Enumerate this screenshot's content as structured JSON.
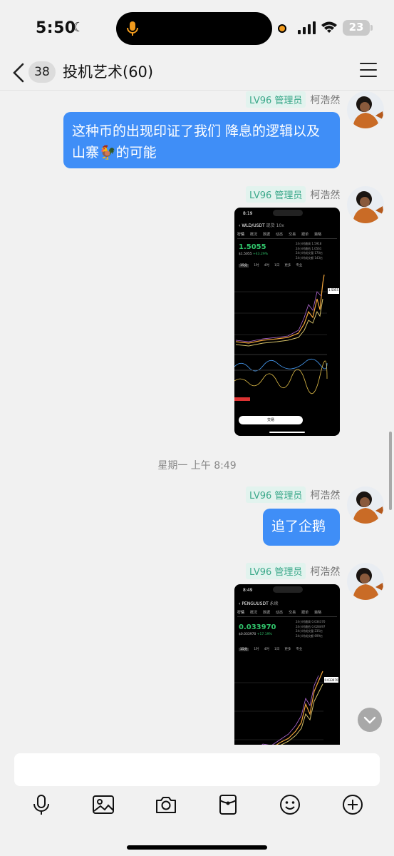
{
  "status_bar": {
    "time": "5:50",
    "battery": "23"
  },
  "header": {
    "unread_count": "38",
    "title": "投机艺术(60)"
  },
  "messages": [
    {
      "type": "text",
      "level": "LV96 管理员",
      "sender": "柯浩然",
      "text": "这种币的出现印证了我们 降息的逻辑以及山寨🐓的可能"
    },
    {
      "type": "image",
      "level": "LV96 管理员",
      "sender": "柯浩然",
      "image": {
        "time": "8:19",
        "pair": "WLD/USDT",
        "tag1": "现货",
        "tag2": "10x",
        "tabs": [
          "行情",
          "概况",
          "数据",
          "动态",
          "交易",
          "跟单",
          "策略"
        ],
        "price": "1.5055",
        "sub_price": "$1.5055",
        "change": "+43.29%",
        "stats": [
          "24小时最高 1.5918",
          "24小时最低 1.0561",
          "24小时成交量 170亿",
          "24小时成交额 143亿"
        ],
        "intervals": [
          "15分",
          "1时",
          "4时",
          "1日",
          "更多",
          "专业"
        ],
        "current_label": "1.5055",
        "trade_button": "交易"
      }
    },
    {
      "type": "timestamp",
      "text": "星期一 上午 8:49"
    },
    {
      "type": "text",
      "level": "LV96 管理员",
      "sender": "柯浩然",
      "text": "追了企鹅"
    },
    {
      "type": "image",
      "level": "LV96 管理员",
      "sender": "柯浩然",
      "image": {
        "time": "8:49",
        "pair": "PENGUUSDT",
        "tag1": "永续",
        "tabs": [
          "行情",
          "概况",
          "数据",
          "动态",
          "交易",
          "跟单",
          "策略"
        ],
        "price": "0.033970",
        "sub_price": "$0.033970",
        "change": "+17.19%",
        "stats": [
          "24小时最高 0.034370",
          "24小时最低 0.028497",
          "24小时成交量 235亿",
          "24小时成交额 699亿"
        ],
        "intervals": [
          "15分",
          "1时",
          "4时",
          "1日",
          "更多",
          "专业"
        ],
        "current_label": "0.033970"
      }
    }
  ],
  "icons": {
    "toolbar": [
      "microphone-icon",
      "image-icon",
      "camera-icon",
      "red-packet-icon",
      "emoji-icon",
      "plus-icon"
    ]
  },
  "colors": {
    "bubble": "#3f8ef7",
    "level_badge_bg": "#e2f3ee",
    "level_badge_text": "#3ba88a",
    "up_green": "#30c46b"
  }
}
